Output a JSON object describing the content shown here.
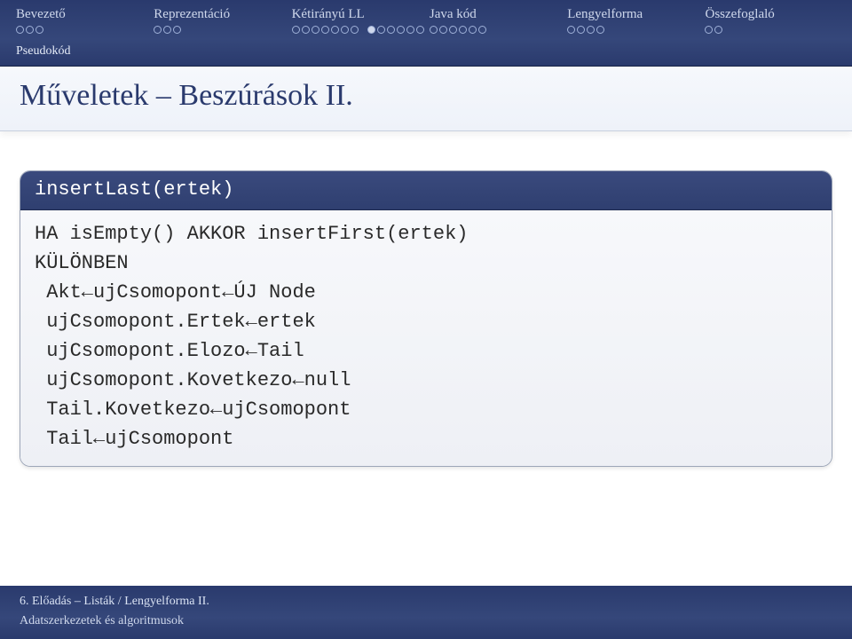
{
  "nav": {
    "items": [
      {
        "label": "Bevezető",
        "dots": "ooo"
      },
      {
        "label": "Reprezentáció",
        "dots": "ooo"
      },
      {
        "label": "Kétirányú LL",
        "dots": "oooooooFooooo"
      },
      {
        "label": "Java kód",
        "dots": "oooooo"
      },
      {
        "label": "Lengyelforma",
        "dots": "oooo"
      },
      {
        "label": "Összefoglaló",
        "dots": "oo"
      }
    ],
    "sub": "Pseudokód"
  },
  "title": "Műveletek – Beszúrások II.",
  "code": {
    "head": "insertLast(ertek)",
    "body": "HA isEmpty() AKKOR insertFirst(ertek)\nKÜLÖNBEN\n Akt←ujCsomopont←ÚJ Node\n ujCsomopont.Ertek←ertek\n ujCsomopont.Elozo←Tail\n ujCsomopont.Kovetkezo←null\n Tail.Kovetkezo←ujCsomopont\n Tail←ujCsomopont"
  },
  "footer": {
    "line1": "6. Előadás – Listák / Lengyelforma II.",
    "line2": "Adatszerkezetek és algoritmusok"
  }
}
